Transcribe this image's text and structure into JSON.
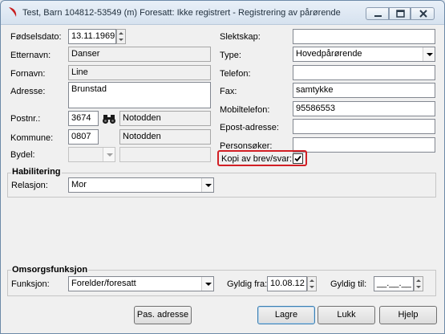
{
  "window": {
    "title": "Test, Barn  104812-53549 (m)  Foresatt: Ikke registrert - Registrering av pårørende"
  },
  "left": {
    "fodselsdato_label": "Fødselsdato:",
    "fodselsdato_value": "13.11.1969",
    "etternavn_label": "Etternavn:",
    "etternavn_value": "Danser",
    "fornavn_label": "Fornavn:",
    "fornavn_value": "Line",
    "adresse_label": "Adresse:",
    "adresse_value": "Brunstad",
    "postnr_label": "Postnr.:",
    "postnr_value": "3674",
    "poststed_value": "Notodden",
    "kommune_label": "Kommune:",
    "kommune_value": "0807",
    "kommune_navn_value": "Notodden",
    "bydel_label": "Bydel:",
    "bydel_value": "",
    "bydel_navn_value": ""
  },
  "right": {
    "slektskap_label": "Slektskap:",
    "slektskap_value": "",
    "type_label": "Type:",
    "type_value": "Hovedpårørende",
    "telefon_label": "Telefon:",
    "telefon_value": "",
    "fax_label": "Fax:",
    "fax_value": "samtykke",
    "mobil_label": "Mobiltelefon:",
    "mobil_value": "95586553",
    "epost_label": "Epost-adresse:",
    "epost_value": "",
    "personsoker_label": "Personsøker:",
    "personsoker_value": "",
    "kopi_label": "Kopi av brev/svar:",
    "kopi_checked": true
  },
  "habilitering": {
    "title": "Habilitering",
    "relasjon_label": "Relasjon:",
    "relasjon_value": "Mor"
  },
  "omsorg": {
    "title": "Omsorgsfunksjon",
    "funksjon_label": "Funksjon:",
    "funksjon_value": "Forelder/foresatt",
    "gyldig_fra_label": "Gyldig fra:",
    "gyldig_fra_value": "10.08.12",
    "gyldig_til_label": "Gyldig til:",
    "gyldig_til_value": "__.__.__"
  },
  "buttons": {
    "pas_adresse": "Pas. adresse",
    "lagre": "Lagre",
    "lukk": "Lukk",
    "hjelp": "Hjelp"
  },
  "icons": {
    "app": "app-icon",
    "lookup": "binoculars-icon",
    "minimize": "minimize-icon",
    "maximize": "maximize-icon",
    "close": "close-icon",
    "checkmark": "checkmark-icon"
  },
  "colors": {
    "highlight": "#d21f25",
    "window_frame": "#6d8aa8"
  }
}
